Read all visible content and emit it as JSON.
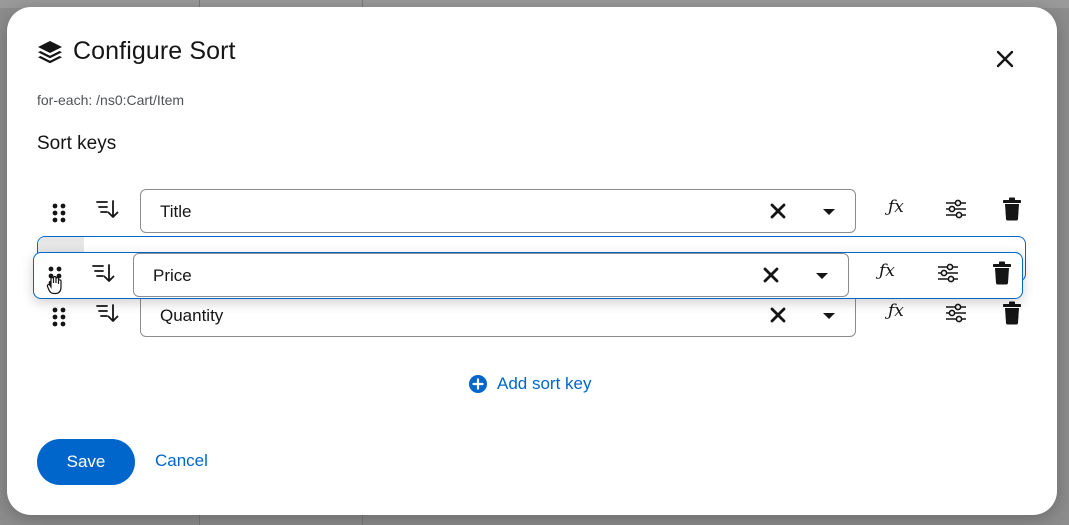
{
  "modal": {
    "title": "Configure Sort",
    "subtitle": "for-each: /ns0:Cart/Item",
    "section_title": "Sort keys",
    "icons": {
      "title": "layers-icon",
      "close": "close-icon"
    }
  },
  "sort_keys": [
    {
      "value": "Title"
    },
    {
      "value": "Quantity"
    }
  ],
  "dragging_key": {
    "value": "Price"
  },
  "row_icons": {
    "drag": "drag-handle-icon",
    "order": "sort-order-icon",
    "clear": "clear-icon",
    "toggle": "caret-down-icon",
    "function": "function-icon",
    "fx_text": "ƒx",
    "filter": "sliders-icon",
    "delete": "trash-icon"
  },
  "actions": {
    "add_sort_key": "Add sort key",
    "save": "Save",
    "cancel": "Cancel"
  },
  "colors": {
    "accent": "#0066cc",
    "text": "#151515",
    "muted": "#4f5255",
    "border": "#8a8d90"
  }
}
